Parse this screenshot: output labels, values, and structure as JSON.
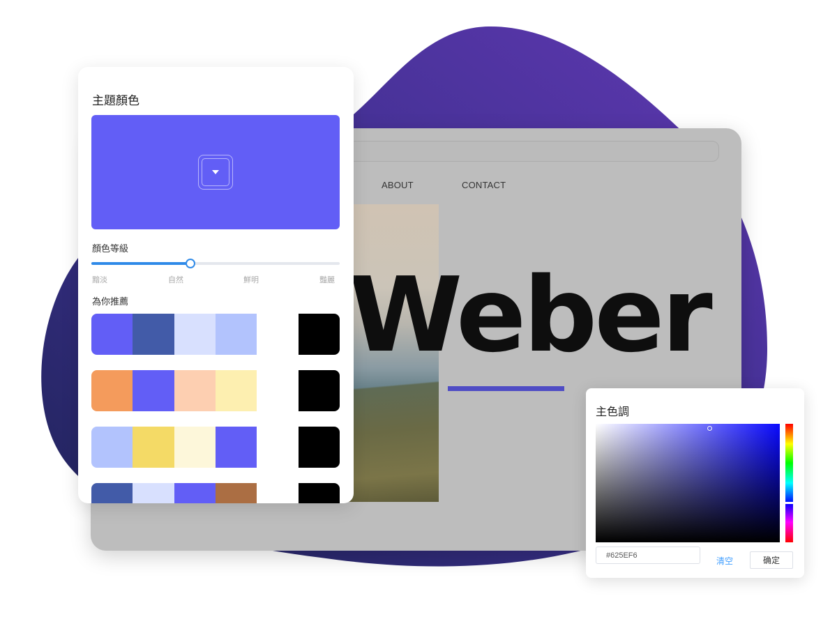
{
  "colors": {
    "blob_start": "#23215c",
    "blob_end": "#5c38ae",
    "accent": "#625EF6",
    "slider": "#2f8ae8"
  },
  "browser": {
    "nav_items": [
      "ABOUT",
      "CONTACT"
    ],
    "hero_title": "Weber"
  },
  "theme_panel": {
    "title": "主題顏色",
    "preview_color": "#625EF6",
    "dropdown_icon": "caret-down-icon",
    "level_label": "顏色等級",
    "level_value_fraction": 0.4,
    "level_ticks": [
      "黯淡",
      "自然",
      "鮮明",
      "豔麗"
    ],
    "recommend_label": "為你推薦",
    "palettes": [
      [
        "#625ef6",
        "#425ba8",
        "#d8e0fe",
        "#b2c3fd",
        "#ffffff",
        "#000000"
      ],
      [
        "#f49b5c",
        "#625ef6",
        "#fdcfb1",
        "#fdefb0",
        "#ffffff",
        "#000000"
      ],
      [
        "#b2c3fd",
        "#f4da66",
        "#fdf7da",
        "#625ef6",
        "#ffffff",
        "#000000"
      ],
      [
        "#425ba8",
        "#d8e0fe",
        "#625ef6",
        "#ab6e43",
        "#ffffff",
        "#000000"
      ]
    ]
  },
  "picker": {
    "title": "主色調",
    "hex_value": "#625EF6",
    "saturation": 0.62,
    "brightness": 0.96,
    "hue_fraction": 0.67,
    "clear_label": "清空",
    "confirm_label": "确定"
  }
}
